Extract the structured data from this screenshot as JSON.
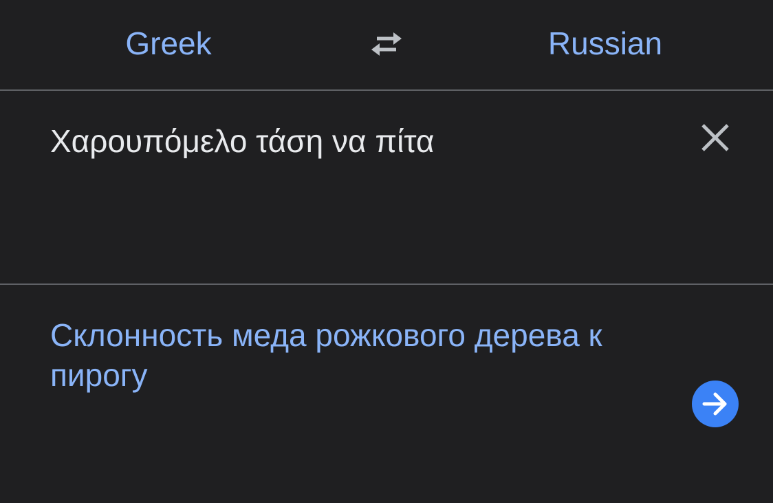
{
  "language_bar": {
    "source_language": "Greek",
    "target_language": "Russian",
    "swap_icon": "swap-arrows-icon"
  },
  "input": {
    "text": "Χαρουπόμελο τάση να πίτα",
    "clear_icon": "close-icon"
  },
  "output": {
    "translation": "Склонность меда рожкового дерева к пирогу",
    "go_icon": "arrow-right-icon"
  },
  "colors": {
    "background": "#1f1f21",
    "accent": "#8ab4f8",
    "button_blue": "#3b82f6",
    "text": "#e8eaed",
    "divider": "#5f6166",
    "icon_gray": "#bdc1c6"
  }
}
